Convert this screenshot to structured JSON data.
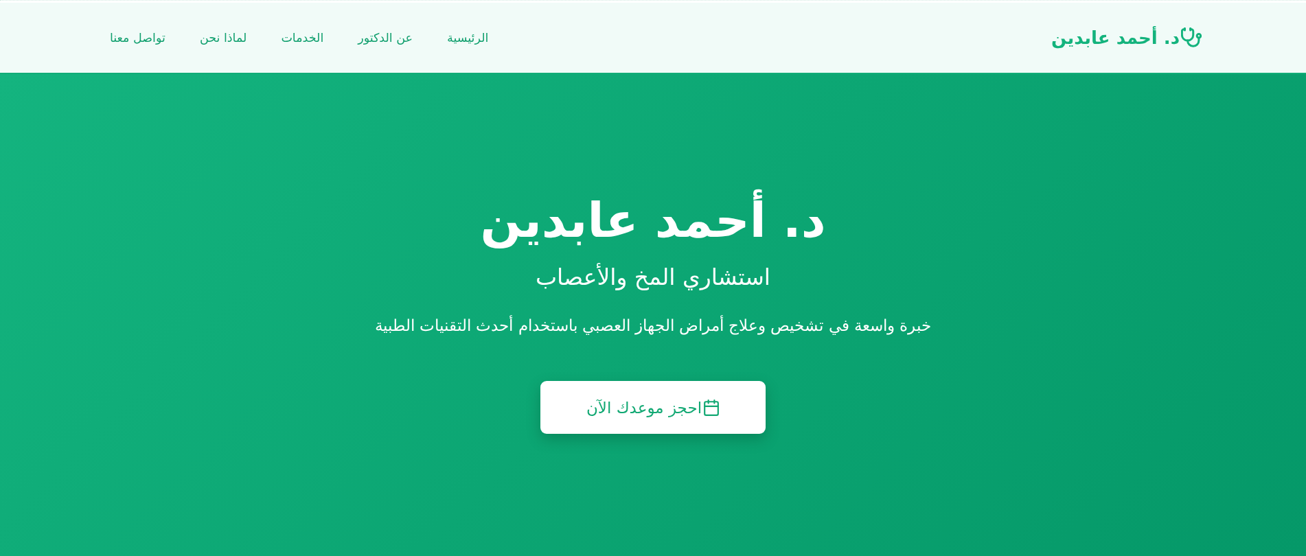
{
  "navbar": {
    "brand": "د. أحمد عابدين",
    "links": [
      {
        "label": "الرئيسية"
      },
      {
        "label": "عن الدكتور"
      },
      {
        "label": "الخدمات"
      },
      {
        "label": "لماذا نحن"
      },
      {
        "label": "تواصل معنا"
      }
    ]
  },
  "hero": {
    "title": "د. أحمد عابدين",
    "subtitle": "استشاري المخ والأعصاب",
    "description": "خبرة واسعة في تشخيص وعلاج أمراض الجهاز العصبي باستخدام أحدث التقنيات الطبية",
    "button": {
      "label": "احجز موعدك الآن"
    }
  }
}
